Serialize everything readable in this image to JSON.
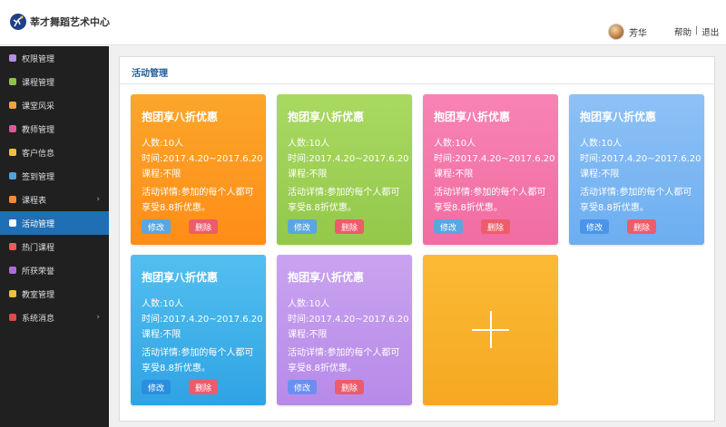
{
  "app": {
    "title": "莘才舞蹈艺术中心"
  },
  "user": {
    "name": "芳华"
  },
  "toplinks": {
    "help": "帮助",
    "separator": "|",
    "logout": "退出"
  },
  "sidebar": {
    "items": [
      {
        "label": "权限管理",
        "icon": "lock-icon",
        "color": "#b48ee3"
      },
      {
        "label": "课程管理",
        "icon": "table-icon",
        "color": "#8bc34a"
      },
      {
        "label": "课堂风采",
        "icon": "sun-icon",
        "color": "#f0a63b"
      },
      {
        "label": "教师管理",
        "icon": "teacher-icon",
        "color": "#e0569a"
      },
      {
        "label": "客户信息",
        "icon": "user-icon",
        "color": "#f0c03b"
      },
      {
        "label": "签到管理",
        "icon": "calendar-icon",
        "color": "#4fa3e0"
      },
      {
        "label": "课程表",
        "icon": "schedule-icon",
        "color": "#f28b3b"
      },
      {
        "label": "活动管理",
        "icon": "document-icon",
        "color": "#ffffff"
      },
      {
        "label": "热门课程",
        "icon": "book-icon",
        "color": "#f05a5a"
      },
      {
        "label": "所获荣誉",
        "icon": "trophy-icon",
        "color": "#b06ad9"
      },
      {
        "label": "教室管理",
        "icon": "home-icon",
        "color": "#f0c03b"
      },
      {
        "label": "系统消息",
        "icon": "bell-icon",
        "color": "#e04a4a"
      }
    ]
  },
  "panel": {
    "title": "活动管理"
  },
  "cards": [
    {
      "title": "抱团享八折优惠",
      "count": "人数:10人",
      "time": "时间:2017.4.20~2017.6.20",
      "course": "课程:不限",
      "detail1": "活动详情:参加的每个人都可",
      "detail2": "享受8.8折优惠。",
      "edit": "修改",
      "delete": "删除",
      "color_top": "#fba62a",
      "color_bottom": "#ff8d17",
      "edit_color": "#5aa6e0"
    },
    {
      "title": "抱团享八折优惠",
      "count": "人数:10人",
      "time": "时间:2017.4.20~2017.6.20",
      "course": "课程:不限",
      "detail1": "活动详情:参加的每个人都可",
      "detail2": "享受8.8折优惠。",
      "edit": "修改",
      "delete": "删除",
      "color_top": "#a9d962",
      "color_bottom": "#93c84a",
      "edit_color": "#5aa6e0"
    },
    {
      "title": "抱团享八折优惠",
      "count": "人数:10人",
      "time": "时间:2017.4.20~2017.6.20",
      "course": "课程:不限",
      "detail1": "活动详情:参加的每个人都可",
      "detail2": "享受8.8折优惠。",
      "edit": "修改",
      "delete": "删除",
      "color_top": "#f883b4",
      "color_bottom": "#f06da2",
      "edit_color": "#5aa6e0"
    },
    {
      "title": "抱团享八折优惠",
      "count": "人数:10人",
      "time": "时间:2017.4.20~2017.6.20",
      "course": "课程:不限",
      "detail1": "活动详情:参加的每个人都可",
      "detail2": "享受8.8折优惠。",
      "edit": "修改",
      "delete": "删除",
      "color_top": "#8ec1f6",
      "color_bottom": "#6caef0",
      "edit_color": "#4a95e8"
    },
    {
      "title": "抱团享八折优惠",
      "count": "人数:10人",
      "time": "时间:2017.4.20~2017.6.20",
      "course": "课程:不限",
      "detail1": "活动详情:参加的每个人都可",
      "detail2": "享受8.8折优惠。",
      "edit": "修改",
      "delete": "删除",
      "color_top": "#52bff0",
      "color_bottom": "#2fa3e3",
      "edit_color": "#2a8fe0"
    },
    {
      "title": "抱团享八折优惠",
      "count": "人数:10人",
      "time": "时间:2017.4.20~2017.6.20",
      "course": "课程:不限",
      "detail1": "活动详情:参加的每个人都可",
      "detail2": "享受8.8折优惠。",
      "edit": "修改",
      "delete": "删除",
      "color_top": "#c9a3f0",
      "color_bottom": "#b78ae8",
      "edit_color": "#6a8ff0"
    }
  ],
  "add_card": {
    "icon": "plus-icon",
    "color_top": "#fbba35",
    "color_bottom": "#f6a822"
  }
}
